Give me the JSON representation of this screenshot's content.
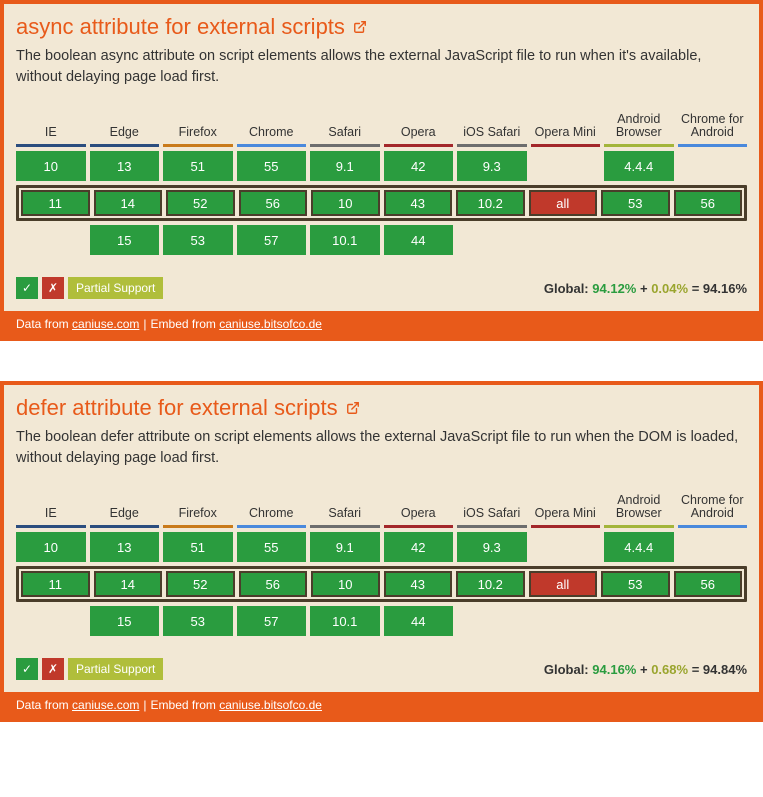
{
  "browsers": [
    {
      "key": "ie",
      "label": "IE"
    },
    {
      "key": "edge",
      "label": "Edge"
    },
    {
      "key": "ff",
      "label": "Firefox"
    },
    {
      "key": "ch",
      "label": "Chrome"
    },
    {
      "key": "sa",
      "label": "Safari"
    },
    {
      "key": "op",
      "label": "Opera"
    },
    {
      "key": "ios",
      "label": "iOS Safari"
    },
    {
      "key": "omini",
      "label": "Opera Mini"
    },
    {
      "key": "ab",
      "label": "Android Browser"
    },
    {
      "key": "cfa",
      "label": "Chrome for Android"
    }
  ],
  "legend": {
    "yes_icon": "✓",
    "no_icon": "✗",
    "partial": "Partial Support"
  },
  "footer": {
    "data_from": "Data from",
    "caniuse": "caniuse.com",
    "embed_from": "Embed from",
    "bitsofco": "caniuse.bitsofco.de"
  },
  "panels": [
    {
      "title": "async attribute for external scripts",
      "desc": "The boolean async attribute on script elements allows the external JavaScript file to run when it's available, without delaying page load first.",
      "rows": {
        "past": [
          {
            "v": "10",
            "s": "sup"
          },
          {
            "v": "13",
            "s": "sup"
          },
          {
            "v": "51",
            "s": "sup"
          },
          {
            "v": "55",
            "s": "sup"
          },
          {
            "v": "9.1",
            "s": "sup"
          },
          {
            "v": "42",
            "s": "sup"
          },
          {
            "v": "9.3",
            "s": "sup"
          },
          {
            "v": "",
            "s": "empty"
          },
          {
            "v": "4.4.4",
            "s": "sup"
          },
          {
            "v": "",
            "s": "empty"
          }
        ],
        "current": [
          {
            "v": "11",
            "s": "sup"
          },
          {
            "v": "14",
            "s": "sup"
          },
          {
            "v": "52",
            "s": "sup"
          },
          {
            "v": "56",
            "s": "sup"
          },
          {
            "v": "10",
            "s": "sup"
          },
          {
            "v": "43",
            "s": "sup"
          },
          {
            "v": "10.2",
            "s": "sup"
          },
          {
            "v": "all",
            "s": "nosup"
          },
          {
            "v": "53",
            "s": "sup"
          },
          {
            "v": "56",
            "s": "sup"
          }
        ],
        "future": [
          {
            "v": "",
            "s": "empty"
          },
          {
            "v": "15",
            "s": "sup"
          },
          {
            "v": "53",
            "s": "sup"
          },
          {
            "v": "57",
            "s": "sup"
          },
          {
            "v": "10.1",
            "s": "sup"
          },
          {
            "v": "44",
            "s": "sup"
          },
          {
            "v": "",
            "s": "empty"
          },
          {
            "v": "",
            "s": "empty"
          },
          {
            "v": "",
            "s": "empty"
          },
          {
            "v": "",
            "s": "empty"
          }
        ]
      },
      "global": {
        "label": "Global:",
        "green": "94.12%",
        "plus": "+",
        "olive": "0.04%",
        "eq": "= 94.16%"
      }
    },
    {
      "title": "defer attribute for external scripts",
      "desc": "The boolean defer attribute on script elements allows the external JavaScript file to run when the DOM is loaded, without delaying page load first.",
      "rows": {
        "past": [
          {
            "v": "10",
            "s": "sup"
          },
          {
            "v": "13",
            "s": "sup"
          },
          {
            "v": "51",
            "s": "sup"
          },
          {
            "v": "55",
            "s": "sup"
          },
          {
            "v": "9.1",
            "s": "sup"
          },
          {
            "v": "42",
            "s": "sup"
          },
          {
            "v": "9.3",
            "s": "sup"
          },
          {
            "v": "",
            "s": "empty"
          },
          {
            "v": "4.4.4",
            "s": "sup"
          },
          {
            "v": "",
            "s": "empty"
          }
        ],
        "current": [
          {
            "v": "11",
            "s": "sup"
          },
          {
            "v": "14",
            "s": "sup"
          },
          {
            "v": "52",
            "s": "sup"
          },
          {
            "v": "56",
            "s": "sup"
          },
          {
            "v": "10",
            "s": "sup"
          },
          {
            "v": "43",
            "s": "sup"
          },
          {
            "v": "10.2",
            "s": "sup"
          },
          {
            "v": "all",
            "s": "nosup"
          },
          {
            "v": "53",
            "s": "sup"
          },
          {
            "v": "56",
            "s": "sup"
          }
        ],
        "future": [
          {
            "v": "",
            "s": "empty"
          },
          {
            "v": "15",
            "s": "sup"
          },
          {
            "v": "53",
            "s": "sup"
          },
          {
            "v": "57",
            "s": "sup"
          },
          {
            "v": "10.1",
            "s": "sup"
          },
          {
            "v": "44",
            "s": "sup"
          },
          {
            "v": "",
            "s": "empty"
          },
          {
            "v": "",
            "s": "empty"
          },
          {
            "v": "",
            "s": "empty"
          },
          {
            "v": "",
            "s": "empty"
          }
        ]
      },
      "global": {
        "label": "Global:",
        "green": "94.16%",
        "plus": "+",
        "olive": "0.68%",
        "eq": "= 94.84%"
      }
    }
  ]
}
